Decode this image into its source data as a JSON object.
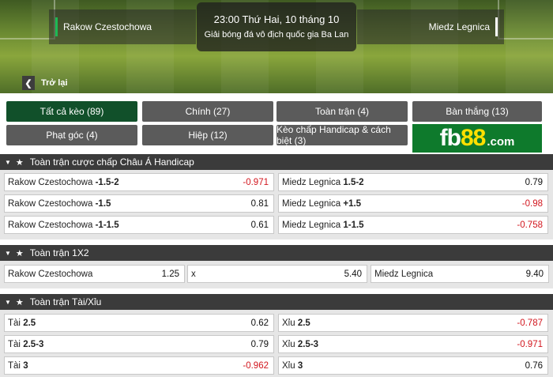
{
  "match": {
    "home": "Rakow Czestochowa",
    "away": "Miedz Legnica",
    "time": "23:00 Thứ Hai, 10 tháng 10",
    "league": "Giải bóng đá vô địch quốc gia Ba Lan",
    "back_label": "Trở lại"
  },
  "tabs": [
    {
      "label": "Tất cả kèo (89)"
    },
    {
      "label": "Chính (27)"
    },
    {
      "label": "Toàn trận (4)"
    },
    {
      "label": "Bàn thắng (13)"
    },
    {
      "label": "Phạt góc (4)"
    },
    {
      "label": "Hiệp (12)"
    },
    {
      "label": "Kèo chấp Handicap & cách biệt (3)"
    }
  ],
  "logo": {
    "fb": "fb",
    "num": "88",
    "com": ".com"
  },
  "sections": [
    {
      "title": "Toàn trận cược chấp Châu Á Handicap",
      "rows": [
        {
          "l_team": "Rakow Czestochowa",
          "l_line": "-1.5-2",
          "l_odd": "-0.971",
          "r_team": "Miedz Legnica",
          "r_line": "1.5-2",
          "r_odd": "0.79"
        },
        {
          "l_team": "Rakow Czestochowa",
          "l_line": "-1.5",
          "l_odd": "0.81",
          "r_team": "Miedz Legnica",
          "r_line": "+1.5",
          "r_odd": "-0.98"
        },
        {
          "l_team": "Rakow Czestochowa",
          "l_line": "-1-1.5",
          "l_odd": "0.61",
          "r_team": "Miedz Legnica",
          "r_line": "1-1.5",
          "r_odd": "-0.758"
        }
      ]
    },
    {
      "title": "Toàn trận 1X2",
      "cells": [
        {
          "label": "Rakow Czestochowa",
          "odd": "1.25"
        },
        {
          "label": "x",
          "odd": "5.40"
        },
        {
          "label": "Miedz Legnica",
          "odd": "9.40"
        }
      ]
    },
    {
      "title": "Toàn trận Tài/Xỉu",
      "rows": [
        {
          "l_team": "Tài",
          "l_line": "2.5",
          "l_odd": "0.62",
          "r_team": "Xỉu",
          "r_line": "2.5",
          "r_odd": "-0.787"
        },
        {
          "l_team": "Tài",
          "l_line": "2.5-3",
          "l_odd": "0.79",
          "r_team": "Xỉu",
          "r_line": "2.5-3",
          "r_odd": "-0.971"
        },
        {
          "l_team": "Tài",
          "l_line": "3",
          "l_odd": "-0.962",
          "r_team": "Xỉu",
          "r_line": "3",
          "r_odd": "0.76"
        }
      ]
    }
  ],
  "colors": {
    "negative_odd": "#d2161e",
    "active_tab": "#11502a",
    "tab": "#5b5b5b",
    "section_header": "#3b3b3b"
  }
}
